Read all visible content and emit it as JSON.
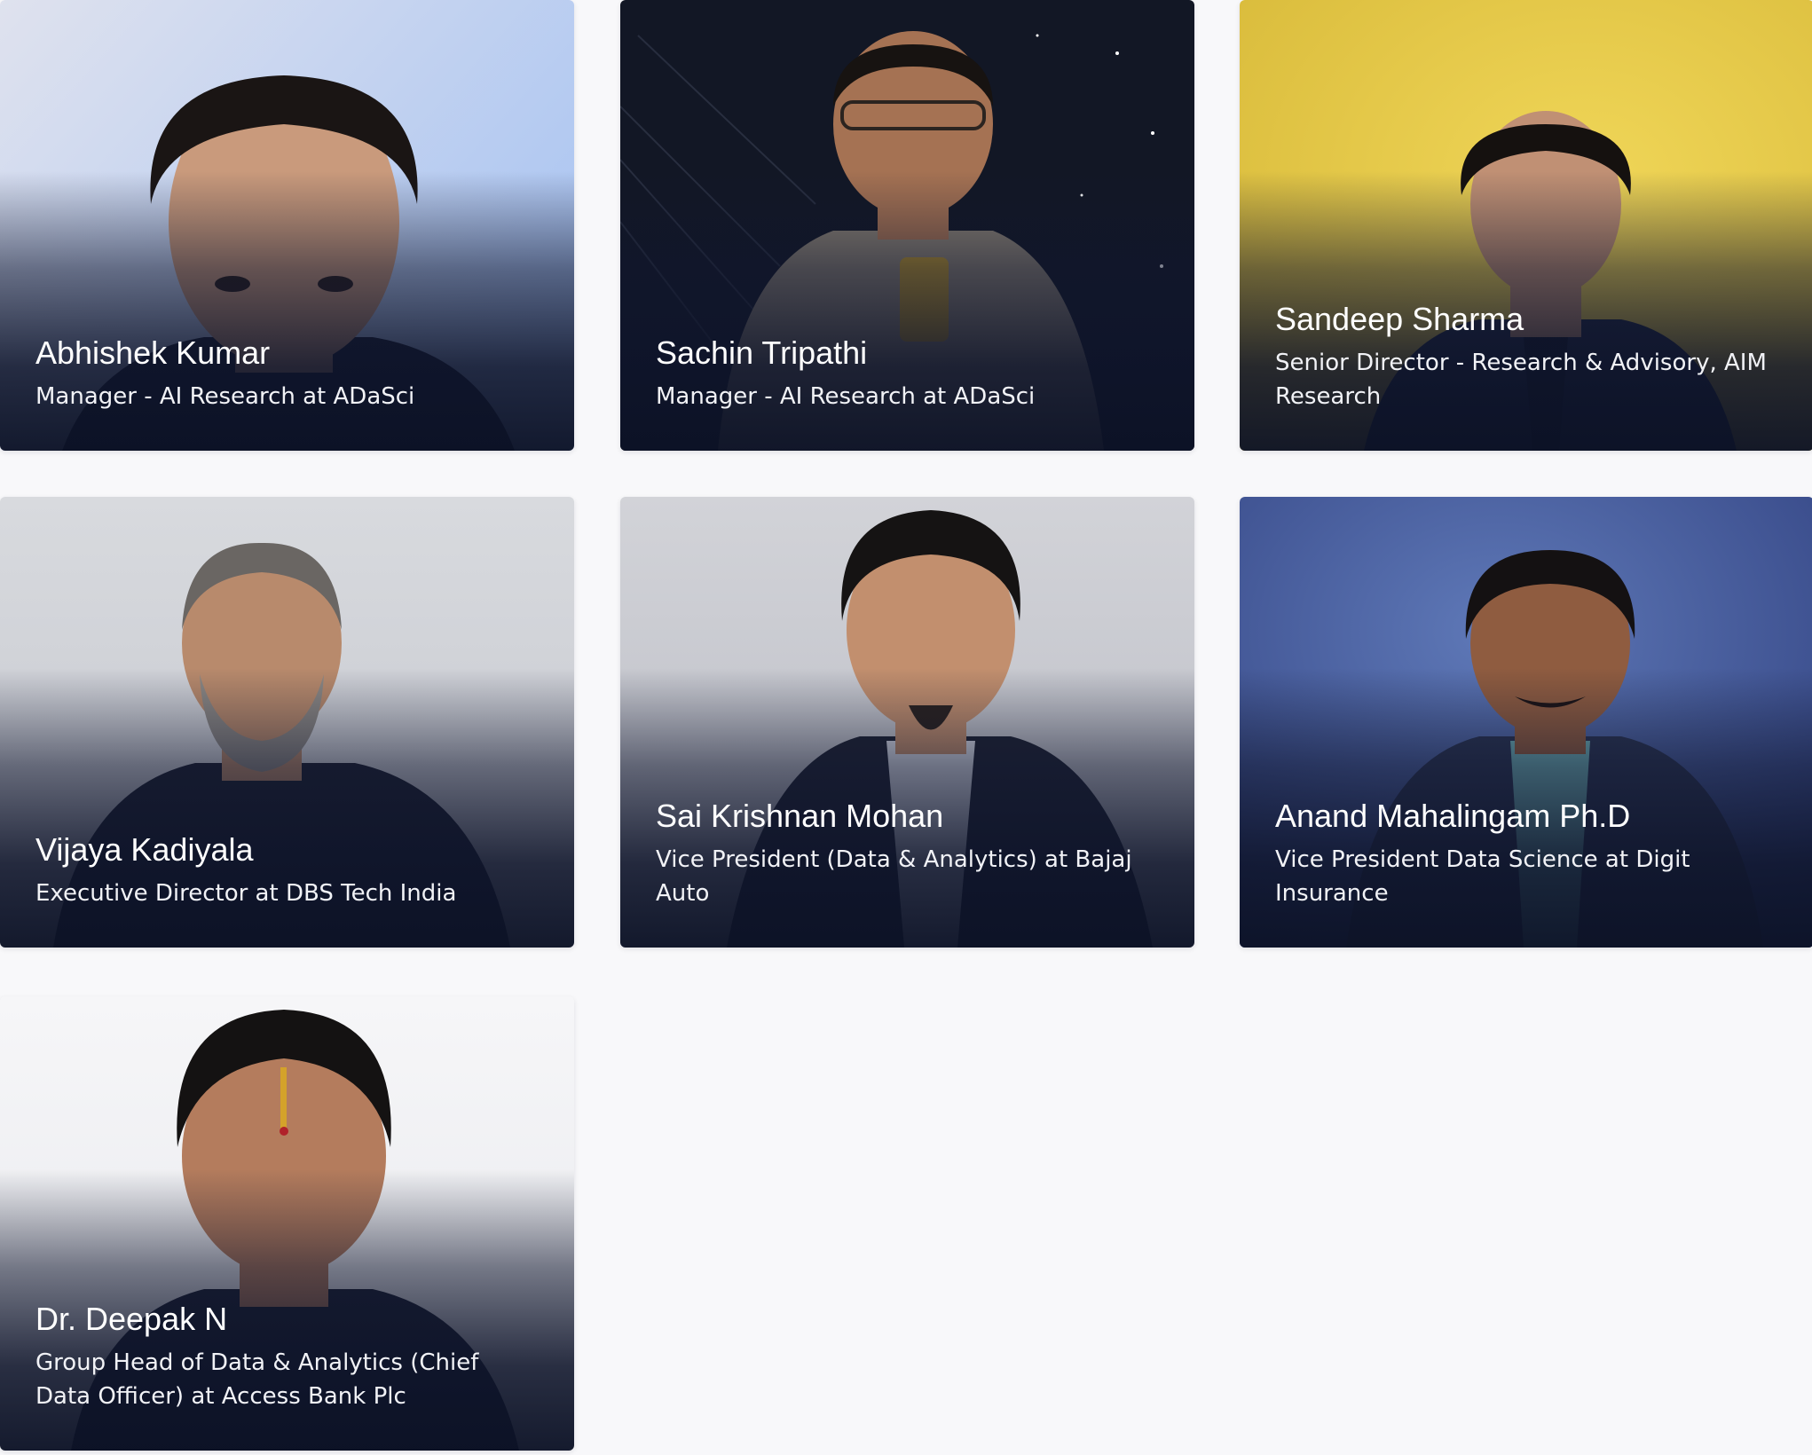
{
  "speakers": [
    {
      "name": "Abhishek Kumar",
      "role": "Manager - AI Research at ADaSci",
      "background": "#dfe2ee",
      "accent": "#a9c4f2",
      "suit": "#141a2e",
      "skin": "#c99a7c",
      "hair": "#1a1514"
    },
    {
      "name": "Sachin Tripathi",
      "role": "Manager - AI Research at ADaSci",
      "background": "#121725",
      "accent": "#3a4155",
      "suit": "#8b8274",
      "skin": "#a57253",
      "hair": "#171311"
    },
    {
      "name": "Sandeep Sharma",
      "role": "Senior Director - Research & Advisory, AIM Research",
      "background": "#d8ba3a",
      "accent": "#f0d658",
      "suit": "#1e2640",
      "skin": "#c09074",
      "hair": "#15110f"
    },
    {
      "name": "Vijaya Kadiyala",
      "role": "Executive Director at DBS Tech India",
      "background": "#c4c6ce",
      "accent": "#d8dade",
      "suit": "#1c2030",
      "skin": "#b88a6c",
      "hair": "#6a6663"
    },
    {
      "name": "Sai Krishnan Mohan",
      "role": "Vice President (Data & Analytics) at Bajaj Auto",
      "background": "#b9bbc4",
      "accent": "#d2d3d8",
      "suit": "#1e2232",
      "skin": "#c28f6e",
      "hair": "#151313"
    },
    {
      "name": "Anand Mahalingam Ph.D",
      "role": "Vice President Data Science at Digit Insurance",
      "background": "#2f3f7e",
      "accent": "#5f79b8",
      "suit": "#2a3452",
      "skin": "#8f5c40",
      "hair": "#141112"
    },
    {
      "name": "Dr. Deepak N",
      "role": "Group Head of Data & Analytics (Chief Data Officer) at Access Bank Plc",
      "background": "#e7e8ec",
      "accent": "#f6f6f8",
      "suit": "#1a1f30",
      "skin": "#b47c5d",
      "hair": "#141212"
    }
  ]
}
